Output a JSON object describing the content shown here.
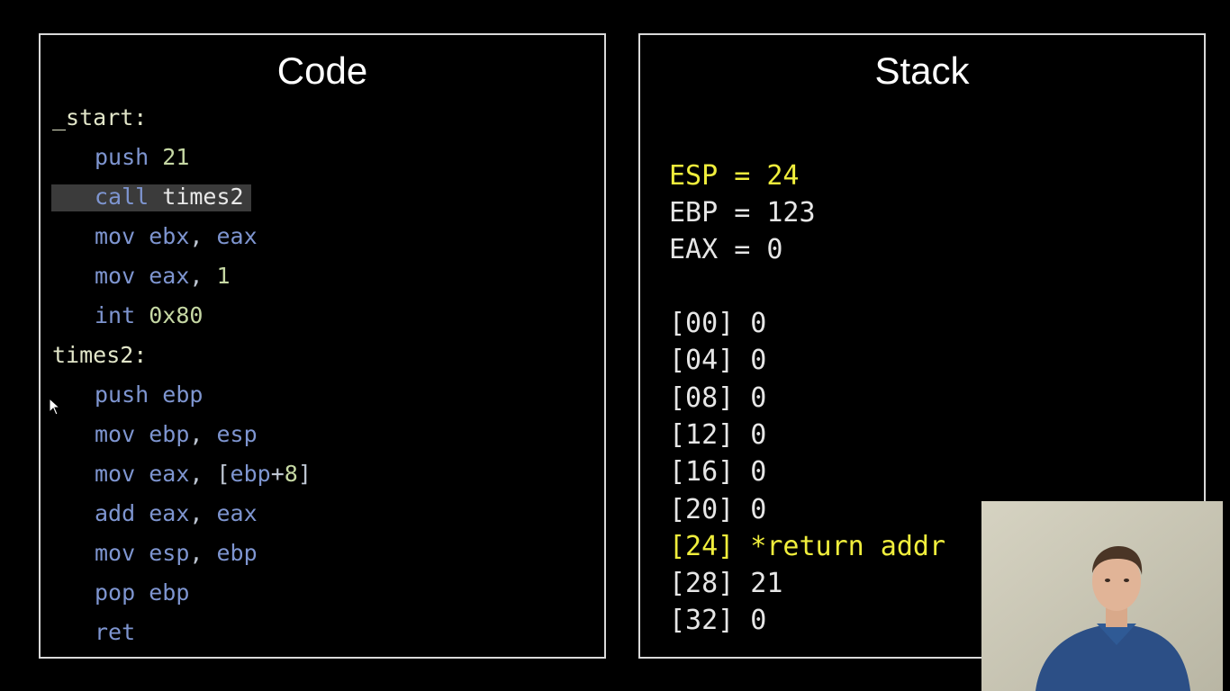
{
  "code_panel": {
    "title": "Code",
    "lines": [
      {
        "label": "_start:"
      },
      {
        "parts": [
          [
            "kw",
            "push "
          ],
          [
            "num",
            "21"
          ]
        ]
      },
      {
        "parts": [
          [
            "kw",
            "call "
          ],
          [
            "id",
            "times2"
          ]
        ],
        "highlighted": true
      },
      {
        "parts": [
          [
            "kw",
            "mov "
          ],
          [
            "reg",
            "ebx"
          ],
          [
            "punc",
            ", "
          ],
          [
            "reg",
            "eax"
          ]
        ]
      },
      {
        "parts": [
          [
            "kw",
            "mov "
          ],
          [
            "reg",
            "eax"
          ],
          [
            "punc",
            ", "
          ],
          [
            "num",
            "1"
          ]
        ]
      },
      {
        "parts": [
          [
            "kw",
            "int "
          ],
          [
            "num",
            "0x80"
          ]
        ]
      },
      {
        "label": "times2:"
      },
      {
        "parts": [
          [
            "kw",
            "push "
          ],
          [
            "reg",
            "ebp"
          ]
        ]
      },
      {
        "parts": [
          [
            "kw",
            "mov "
          ],
          [
            "reg",
            "ebp"
          ],
          [
            "punc",
            ", "
          ],
          [
            "reg",
            "esp"
          ]
        ]
      },
      {
        "parts": [
          [
            "kw",
            "mov "
          ],
          [
            "reg",
            "eax"
          ],
          [
            "punc",
            ", ["
          ],
          [
            "reg",
            "ebp"
          ],
          [
            "punc",
            "+"
          ],
          [
            "num",
            "8"
          ],
          [
            "punc",
            "]"
          ]
        ]
      },
      {
        "parts": [
          [
            "kw",
            "add "
          ],
          [
            "reg",
            "eax"
          ],
          [
            "punc",
            ", "
          ],
          [
            "reg",
            "eax"
          ]
        ]
      },
      {
        "parts": [
          [
            "kw",
            "mov "
          ],
          [
            "reg",
            "esp"
          ],
          [
            "punc",
            ", "
          ],
          [
            "reg",
            "ebp"
          ]
        ]
      },
      {
        "parts": [
          [
            "kw",
            "pop "
          ],
          [
            "reg",
            "ebp"
          ]
        ]
      },
      {
        "parts": [
          [
            "kw",
            "ret"
          ]
        ]
      }
    ]
  },
  "stack_panel": {
    "title": "Stack",
    "registers": [
      {
        "text": "ESP = 24",
        "highlight": true
      },
      {
        "text": "EBP = 123",
        "highlight": false
      },
      {
        "text": "EAX = 0",
        "highlight": false
      }
    ],
    "entries": [
      {
        "text": "[00] 0",
        "highlight": false
      },
      {
        "text": "[04] 0",
        "highlight": false
      },
      {
        "text": "[08] 0",
        "highlight": false
      },
      {
        "text": "[12] 0",
        "highlight": false
      },
      {
        "text": "[16] 0",
        "highlight": false
      },
      {
        "text": "[20] 0",
        "highlight": false
      },
      {
        "text": "[24] *return addr",
        "highlight": true
      },
      {
        "text": "[28] 21",
        "highlight": false
      },
      {
        "text": "[32] 0",
        "highlight": false
      }
    ]
  },
  "colors": {
    "keyword": "#7e95d0",
    "number": "#c6d8a4",
    "highlight_yellow": "#f0ee3c",
    "line_highlight": "#3b3b3b"
  }
}
